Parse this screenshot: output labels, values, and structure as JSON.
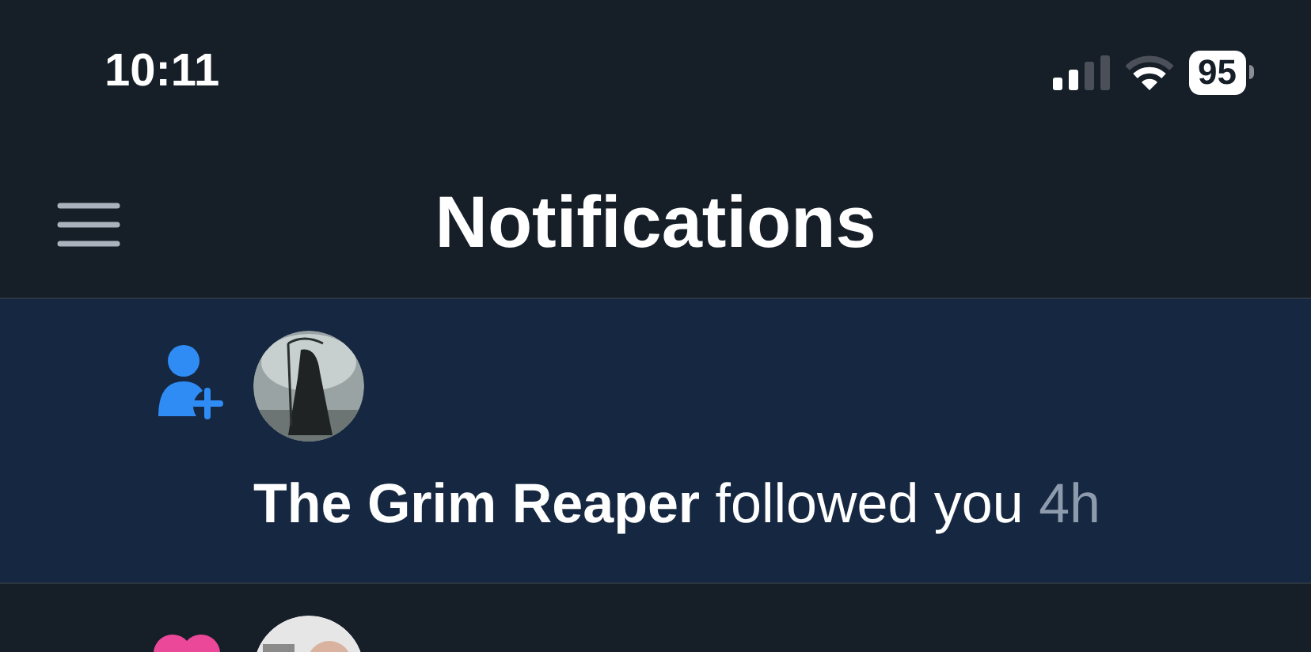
{
  "status_bar": {
    "time": "10:11",
    "battery": "95"
  },
  "header": {
    "title": "Notifications"
  },
  "notifications": [
    {
      "kind": "follow",
      "unread": true,
      "name": "The Grim Reaper",
      "action": "followed you",
      "time": "4h"
    },
    {
      "kind": "like",
      "unread": false
    }
  ]
}
